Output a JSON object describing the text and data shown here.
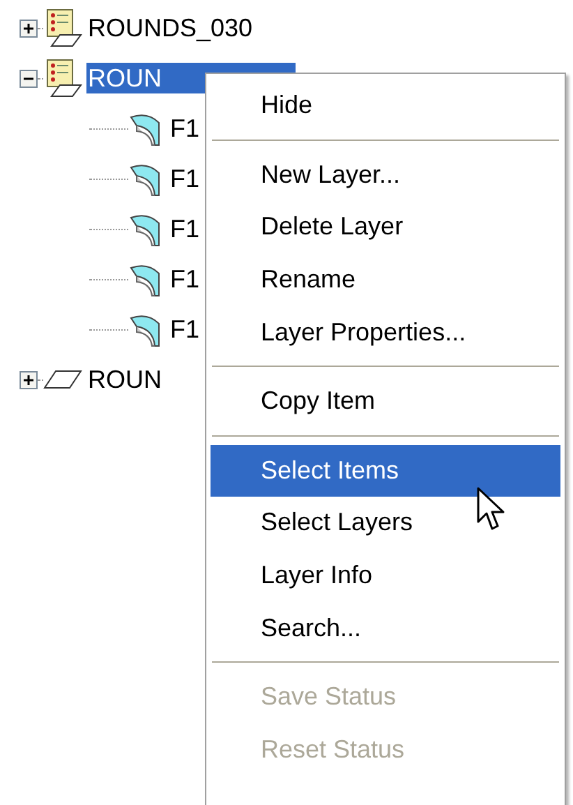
{
  "tree": [
    {
      "label": "ROUNDS_030",
      "kind": "layer",
      "expanded": false,
      "selected": false
    },
    {
      "label": "ROUN",
      "kind": "layer",
      "expanded": true,
      "selected": true,
      "children": [
        {
          "label": "F1"
        },
        {
          "label": "F1"
        },
        {
          "label": "F1"
        },
        {
          "label": "F1"
        },
        {
          "label": "F1"
        }
      ]
    },
    {
      "label": "ROUN",
      "kind": "plane",
      "expanded": false,
      "selected": false
    }
  ],
  "context_menu": [
    {
      "kind": "item",
      "label": "Hide",
      "selected": false,
      "disabled": false
    },
    {
      "kind": "separator"
    },
    {
      "kind": "item",
      "label": "New Layer...",
      "selected": false,
      "disabled": false
    },
    {
      "kind": "item",
      "label": "Delete Layer",
      "selected": false,
      "disabled": false
    },
    {
      "kind": "item",
      "label": "Rename",
      "selected": false,
      "disabled": false
    },
    {
      "kind": "item",
      "label": "Layer Properties...",
      "selected": false,
      "disabled": false
    },
    {
      "kind": "separator"
    },
    {
      "kind": "item",
      "label": "Copy Item",
      "selected": false,
      "disabled": false
    },
    {
      "kind": "separator"
    },
    {
      "kind": "item",
      "label": "Select Items",
      "selected": true,
      "disabled": false
    },
    {
      "kind": "item",
      "label": "Select Layers",
      "selected": false,
      "disabled": false
    },
    {
      "kind": "item",
      "label": "Layer Info",
      "selected": false,
      "disabled": false
    },
    {
      "kind": "item",
      "label": "Search...",
      "selected": false,
      "disabled": false
    },
    {
      "kind": "separator"
    },
    {
      "kind": "item",
      "label": "Save Status",
      "selected": false,
      "disabled": true
    },
    {
      "kind": "item",
      "label": "Reset Status",
      "selected": false,
      "disabled": true
    }
  ]
}
